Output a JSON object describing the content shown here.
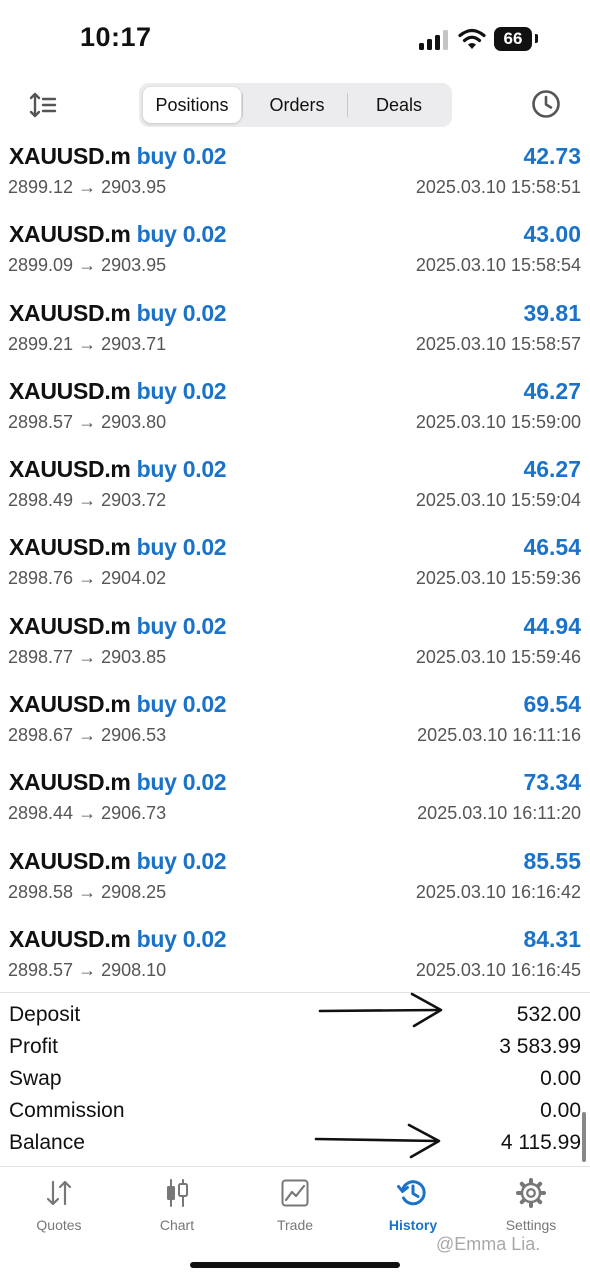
{
  "status_bar": {
    "time": "10:17",
    "battery": "66"
  },
  "toolbar": {
    "tabs": [
      "Positions",
      "Orders",
      "Deals"
    ],
    "active_tab": "Positions"
  },
  "positions": [
    {
      "symbol": "XAUUSD.m",
      "side": "buy 0.02",
      "prices": "2899.12 → 2903.95",
      "profit": "42.73",
      "time": "2025.03.10 15:58:51"
    },
    {
      "symbol": "XAUUSD.m",
      "side": "buy 0.02",
      "prices": "2899.09 → 2903.95",
      "profit": "43.00",
      "time": "2025.03.10 15:58:54"
    },
    {
      "symbol": "XAUUSD.m",
      "side": "buy 0.02",
      "prices": "2899.21 → 2903.71",
      "profit": "39.81",
      "time": "2025.03.10 15:58:57"
    },
    {
      "symbol": "XAUUSD.m",
      "side": "buy 0.02",
      "prices": "2898.57 → 2903.80",
      "profit": "46.27",
      "time": "2025.03.10 15:59:00"
    },
    {
      "symbol": "XAUUSD.m",
      "side": "buy 0.02",
      "prices": "2898.49 → 2903.72",
      "profit": "46.27",
      "time": "2025.03.10 15:59:04"
    },
    {
      "symbol": "XAUUSD.m",
      "side": "buy 0.02",
      "prices": "2898.76 → 2904.02",
      "profit": "46.54",
      "time": "2025.03.10 15:59:36"
    },
    {
      "symbol": "XAUUSD.m",
      "side": "buy 0.02",
      "prices": "2898.77 → 2903.85",
      "profit": "44.94",
      "time": "2025.03.10 15:59:46"
    },
    {
      "symbol": "XAUUSD.m",
      "side": "buy 0.02",
      "prices": "2898.67 → 2906.53",
      "profit": "69.54",
      "time": "2025.03.10 16:11:16"
    },
    {
      "symbol": "XAUUSD.m",
      "side": "buy 0.02",
      "prices": "2898.44 → 2906.73",
      "profit": "73.34",
      "time": "2025.03.10 16:11:20"
    },
    {
      "symbol": "XAUUSD.m",
      "side": "buy 0.02",
      "prices": "2898.58 → 2908.25",
      "profit": "85.55",
      "time": "2025.03.10 16:16:42"
    },
    {
      "symbol": "XAUUSD.m",
      "side": "buy 0.02",
      "prices": "2898.57 → 2908.10",
      "profit": "84.31",
      "time": "2025.03.10 16:16:45"
    }
  ],
  "summary": [
    {
      "label": "Deposit",
      "value": "532.00"
    },
    {
      "label": "Profit",
      "value": "3 583.99"
    },
    {
      "label": "Swap",
      "value": "0.00"
    },
    {
      "label": "Commission",
      "value": "0.00"
    },
    {
      "label": "Balance",
      "value": "4 115.99"
    }
  ],
  "tabbar": {
    "items": [
      {
        "label": "Quotes",
        "icon": "quotes-arrows-icon"
      },
      {
        "label": "Chart",
        "icon": "candlestick-chart-icon"
      },
      {
        "label": "Trade",
        "icon": "trade-chart-icon"
      },
      {
        "label": "History",
        "icon": "history-clock-icon"
      },
      {
        "label": "Settings",
        "icon": "gear-icon"
      }
    ],
    "active": "History"
  },
  "watermark": "@Emma Lia.",
  "colors": {
    "accent": "#1a73c8",
    "text": "#111111",
    "muted": "#555555"
  }
}
